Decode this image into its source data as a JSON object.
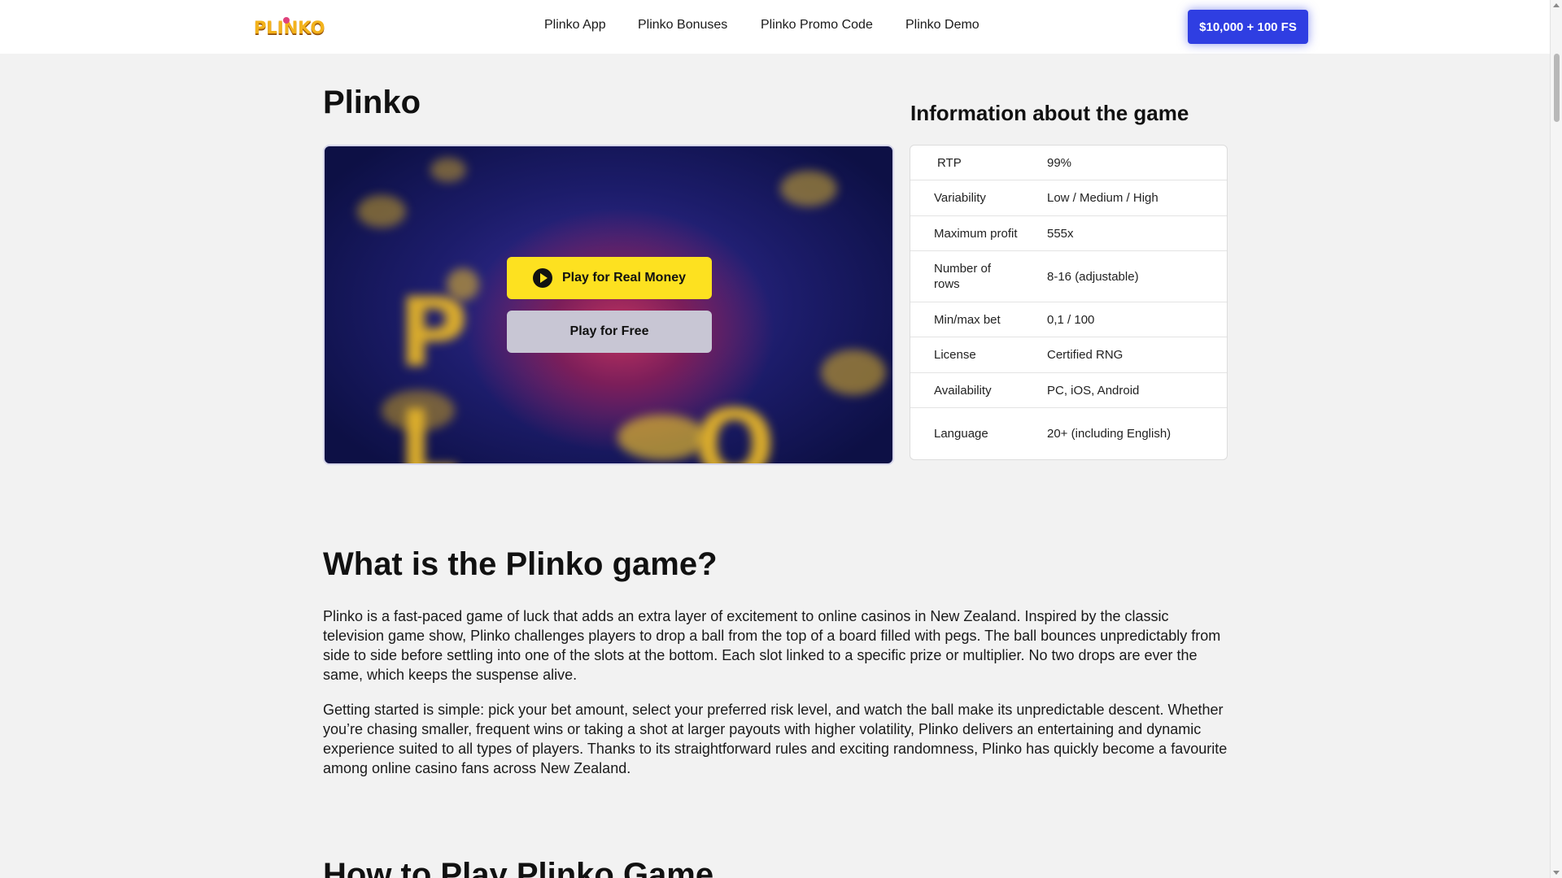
{
  "header": {
    "logo_text": "PLINKO",
    "nav": [
      "Plinko App",
      "Plinko Bonuses",
      "Plinko Promo Code",
      "Plinko Demo"
    ],
    "cta_label": "$10,000 + 100 FS"
  },
  "main": {
    "title": "Plinko",
    "game": {
      "play_real_label": "Play for Real Money",
      "play_free_label": "Play for Free"
    }
  },
  "info": {
    "title": "Information about the game",
    "rows": [
      {
        "label": "RTP",
        "value": "99%"
      },
      {
        "label": "Variability",
        "value": "Low / Medium / High"
      },
      {
        "label": "Maximum profit",
        "value": "555x"
      },
      {
        "label": "Number of rows",
        "value": "8-16 (adjustable)"
      },
      {
        "label": "Min/max bet",
        "value": "0,1 / 100"
      },
      {
        "label": "License",
        "value": "Certified RNG"
      },
      {
        "label": "Availability",
        "value": "PC, iOS, Android"
      },
      {
        "label": "Language",
        "value": "20+ (including English)"
      }
    ]
  },
  "article": {
    "heading": "What is the Plinko game?",
    "paragraphs": [
      "Plinko is a fast-paced game of luck that adds an extra layer of excitement to online casinos in New Zealand. Inspired by the classic television game show, Plinko challenges players to drop a ball from the top of a board filled with pegs. The ball bounces unpredictably from side to side before settling into one of the slots at the bottom. Each slot linked to a specific prize or multiplier. No two drops are ever the same, which keeps the suspense alive.",
      "Getting started is simple: pick your bet amount, select your preferred risk level, and watch the ball make its unpredictable descent. Whether you’re chasing smaller, frequent wins or taking a shot at larger payouts with higher volatility, Plinko delivers an entertaining and dynamic experience suited to all types of players. Thanks to its straightforward rules and exciting randomness, Plinko has quickly become a favourite among online casino fans across New Zealand."
    ],
    "next_heading": "How to Play Plinko Game"
  },
  "colors": {
    "cta_blue": "#2f3ee2",
    "play_yellow": "#fde120",
    "free_gray": "#c8c6d4",
    "logo_gold": "#f3b31c"
  }
}
